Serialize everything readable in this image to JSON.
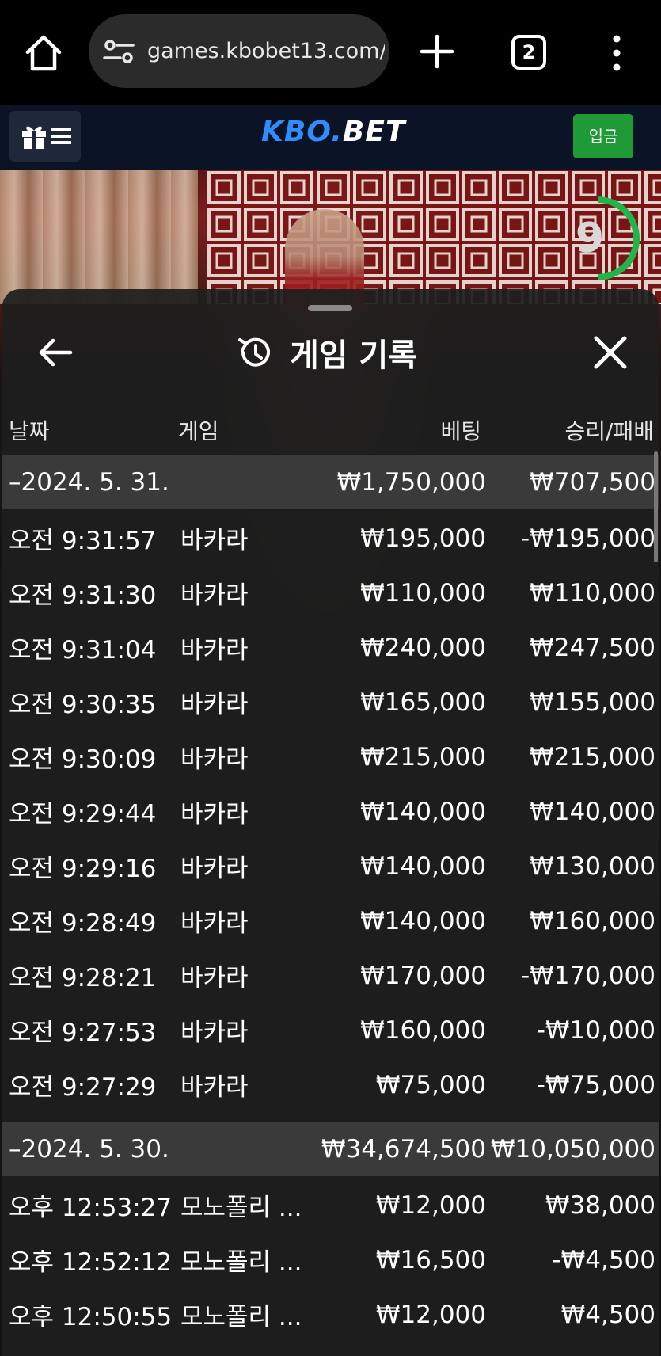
{
  "browser": {
    "url": "games.kbobet13.com/",
    "tab_count": "2"
  },
  "site": {
    "logo_kbo": "KBO.",
    "logo_bet": "BET",
    "deposit_label": "입금"
  },
  "video": {
    "timer_value": "9"
  },
  "panel": {
    "title": "게임 기록",
    "columns": {
      "date": "날짜",
      "game": "게임",
      "bet": "베팅",
      "result": "승리/패배"
    },
    "groups": [
      {
        "date": "–2024. 5. 31.",
        "total_bet": "₩1,750,000",
        "total_result": "₩707,500",
        "rows": [
          {
            "time": "오전 9:31:57",
            "game": "바카라",
            "bet": "₩195,000",
            "result": "-₩195,000"
          },
          {
            "time": "오전 9:31:30",
            "game": "바카라",
            "bet": "₩110,000",
            "result": "₩110,000"
          },
          {
            "time": "오전 9:31:04",
            "game": "바카라",
            "bet": "₩240,000",
            "result": "₩247,500"
          },
          {
            "time": "오전 9:30:35",
            "game": "바카라",
            "bet": "₩165,000",
            "result": "₩155,000"
          },
          {
            "time": "오전 9:30:09",
            "game": "바카라",
            "bet": "₩215,000",
            "result": "₩215,000"
          },
          {
            "time": "오전 9:29:44",
            "game": "바카라",
            "bet": "₩140,000",
            "result": "₩140,000"
          },
          {
            "time": "오전 9:29:16",
            "game": "바카라",
            "bet": "₩140,000",
            "result": "₩130,000"
          },
          {
            "time": "오전 9:28:49",
            "game": "바카라",
            "bet": "₩140,000",
            "result": "₩160,000"
          },
          {
            "time": "오전 9:28:21",
            "game": "바카라",
            "bet": "₩170,000",
            "result": "-₩170,000"
          },
          {
            "time": "오전 9:27:53",
            "game": "바카라",
            "bet": "₩160,000",
            "result": "-₩10,000"
          },
          {
            "time": "오전 9:27:29",
            "game": "바카라",
            "bet": "₩75,000",
            "result": "-₩75,000"
          }
        ]
      },
      {
        "date": "–2024. 5. 30.",
        "total_bet": "₩34,674,500",
        "total_result": "₩10,050,000",
        "rows": [
          {
            "time": "오후 12:53:27",
            "game": "모노폴리 ...",
            "bet": "₩12,000",
            "result": "₩38,000"
          },
          {
            "time": "오후 12:52:12",
            "game": "모노폴리 ...",
            "bet": "₩16,500",
            "result": "-₩4,500"
          },
          {
            "time": "오후 12:50:55",
            "game": "모노폴리 ...",
            "bet": "₩12,000",
            "result": "₩4,500"
          }
        ]
      }
    ]
  },
  "colors": {
    "deposit_green": "#1e9b36",
    "logo_blue": "#2f8dff",
    "timer_green": "#22b34a",
    "date_row_bg": "#3a3a3a"
  }
}
